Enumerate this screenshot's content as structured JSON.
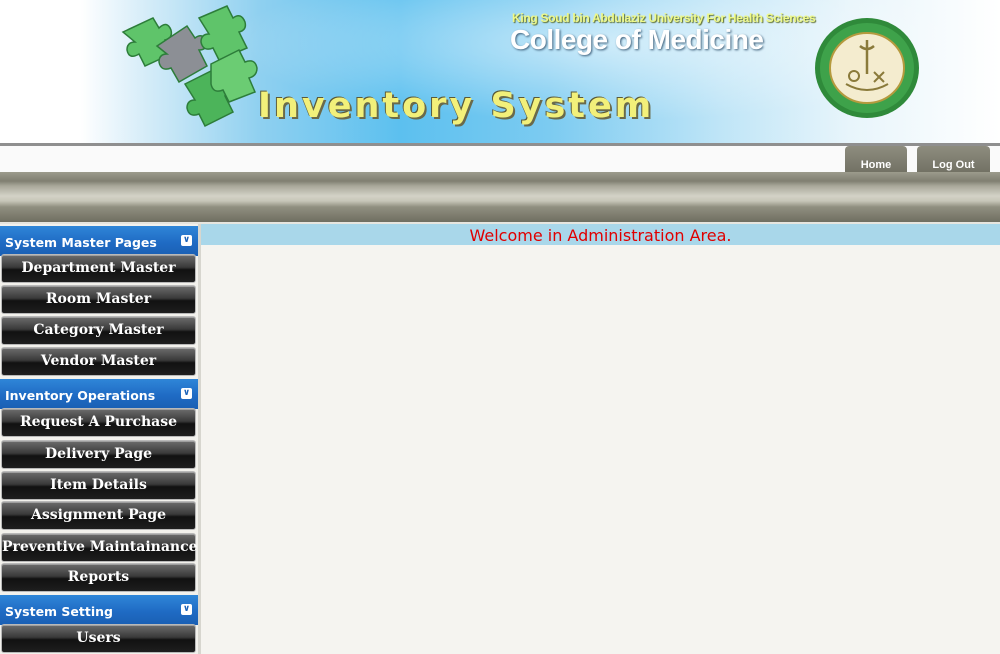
{
  "header": {
    "university": "King Soud bin Abdulaziz University For Health Sciences",
    "college": "College of Medicine",
    "system_title": "Inventory System",
    "logo_icon": "puzzle-pieces-icon",
    "seal_icon": "university-seal-icon"
  },
  "nav": {
    "tabs": [
      {
        "label": "Home"
      },
      {
        "label": "Log Out"
      }
    ]
  },
  "sidebar": {
    "sections": [
      {
        "title": "System Master Pages",
        "items": [
          "Department Master",
          "Room Master",
          "Category Master",
          "Vendor Master"
        ]
      },
      {
        "title": "Inventory Operations",
        "items": [
          "Request A Purchase",
          "Delivery Page",
          "Item Details",
          "Assignment Page",
          "Preventive Maintainance",
          "Reports"
        ]
      },
      {
        "title": "System Setting",
        "items": [
          "Users"
        ]
      }
    ],
    "collapse_icon": "double-chevron-down-icon"
  },
  "main": {
    "welcome": "Welcome in Administration Area."
  },
  "colors": {
    "section_header": "#1f6bc4",
    "welcome_text": "#e00000",
    "welcome_bar": "#a9d7ea"
  }
}
